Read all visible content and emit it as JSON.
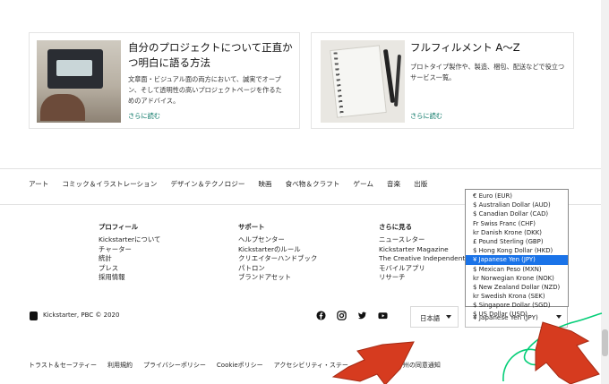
{
  "cards": [
    {
      "title_line1": "自分のプロジェクトについて正直か",
      "title_line2": "つ明白に語る方法",
      "desc": "文章面・ビジュアル面の両方において、誠実でオープン、そして透明性の高いプロジェクトページを作るためのアドバイス。",
      "link": "さらに読む"
    },
    {
      "title_line1": "フルフィルメント A～Z",
      "desc": "プロトタイプ製作や、製造、梱包、配送などで役立つサービス一覧。",
      "link": "さらに読む"
    }
  ],
  "categories": [
    "アート",
    "コミック＆イラストレーション",
    "デザイン＆テクノロジー",
    "映画",
    "食べ物＆クラフト",
    "ゲーム",
    "音楽",
    "出版"
  ],
  "footer_columns": [
    {
      "heading": "プロフィール",
      "items": [
        "Kickstarterについて",
        "チャーター",
        "統計",
        "プレス",
        "採用情報"
      ]
    },
    {
      "heading": "サポート",
      "items": [
        "ヘルプセンター",
        "Kickstarterのルール",
        "クリエイターハンドブック",
        "パトロン",
        "ブランドアセット"
      ]
    },
    {
      "heading": "さらに見る",
      "items": [
        "ニュースレター",
        "Kickstarter Magazine",
        "The Creative Independent",
        "モバイルアプリ",
        "リサーチ"
      ]
    }
  ],
  "copyright": "Kickstarter, PBC © 2020",
  "social_icons": [
    "facebook-icon",
    "instagram-icon",
    "twitter-icon",
    "youtube-icon"
  ],
  "language": {
    "selected": "日本語"
  },
  "currency": {
    "selected": "¥ Japanese Yen (JPY)",
    "selected_index": 7,
    "options": [
      "€ Euro (EUR)",
      "$ Australian Dollar (AUD)",
      "$ Canadian Dollar (CAD)",
      "Fr Swiss Franc (CHF)",
      "kr Danish Krone (DKK)",
      "£ Pound Sterling (GBP)",
      "$ Hong Kong Dollar (HKD)",
      "¥ Japanese Yen (JPY)",
      "$ Mexican Peso (MXN)",
      "kr Norwegian Krone (NOK)",
      "$ New Zealand Dollar (NZD)",
      "kr Swedish Krona (SEK)",
      "$ Singapore Dollar (SGD)",
      "$ US Dollar (USD)"
    ]
  },
  "bottom_links": [
    "トラスト＆セーフティー",
    "利用規約",
    "プライバシーポリシー",
    "Cookieポリシー",
    "アクセシビリティ・ステー",
    "カリフォルニア州の同意通知"
  ],
  "colors": {
    "link": "#037362",
    "selected_option": "#1a73e8",
    "arrow": "#d63b1f",
    "squiggle": "#05ce78"
  }
}
